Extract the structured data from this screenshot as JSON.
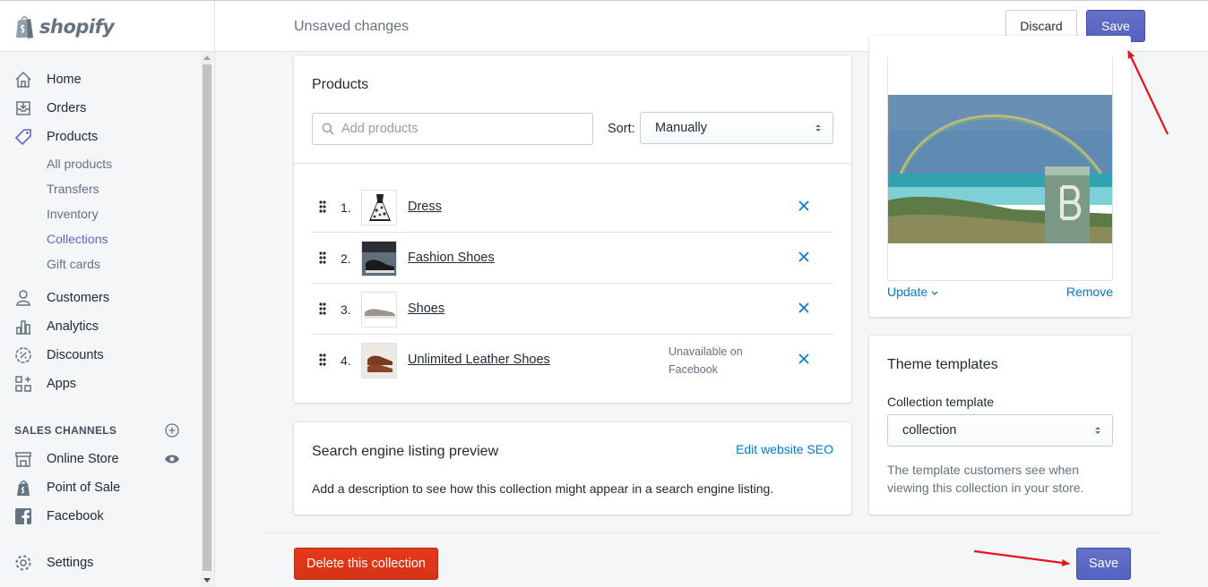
{
  "brand": {
    "name": "shopify"
  },
  "topbar": {
    "status": "Unsaved changes",
    "discard_label": "Discard",
    "save_label": "Save"
  },
  "sidebar": {
    "items": [
      {
        "label": "Home",
        "icon": "home-icon"
      },
      {
        "label": "Orders",
        "icon": "orders-icon"
      },
      {
        "label": "Products",
        "icon": "tag-icon"
      }
    ],
    "sub_items": [
      "All products",
      "Transfers",
      "Inventory",
      "Collections",
      "Gift cards"
    ],
    "active_sub": "Collections",
    "items2": [
      {
        "label": "Customers",
        "icon": "customer-icon"
      },
      {
        "label": "Analytics",
        "icon": "analytics-icon"
      },
      {
        "label": "Discounts",
        "icon": "discount-icon"
      },
      {
        "label": "Apps",
        "icon": "apps-icon"
      }
    ],
    "sales_channels_header": "SALES CHANNELS",
    "channels": [
      {
        "label": "Online Store",
        "icon": "store-icon"
      },
      {
        "label": "Point of Sale",
        "icon": "pos-icon"
      },
      {
        "label": "Facebook",
        "icon": "facebook-icon"
      }
    ],
    "settings_label": "Settings"
  },
  "products_card": {
    "title": "Products",
    "search_placeholder": "Add products",
    "sort_label": "Sort:",
    "sort_value": "Manually",
    "rows": [
      {
        "num": "1.",
        "name": "Dress",
        "note": ""
      },
      {
        "num": "2.",
        "name": "Fashion Shoes",
        "note": ""
      },
      {
        "num": "3.",
        "name": "Shoes",
        "note": ""
      },
      {
        "num": "4.",
        "name": "Unlimited Leather Shoes",
        "note": "Unavailable on Facebook"
      }
    ]
  },
  "seo_card": {
    "title": "Search engine listing preview",
    "edit_link": "Edit website SEO",
    "description": "Add a description to see how this collection might appear in a search engine listing."
  },
  "image_card": {
    "update_label": "Update",
    "remove_label": "Remove"
  },
  "theme_card": {
    "title": "Theme templates",
    "field_label": "Collection template",
    "value": "collection",
    "help": "The template customers see when viewing this collection in your store."
  },
  "footer": {
    "delete_label": "Delete this collection",
    "save_label": "Save"
  },
  "colors": {
    "primary": "#5c6ac4",
    "destructive": "#de3618",
    "link": "#007ace",
    "annotation": "#e8141c"
  }
}
